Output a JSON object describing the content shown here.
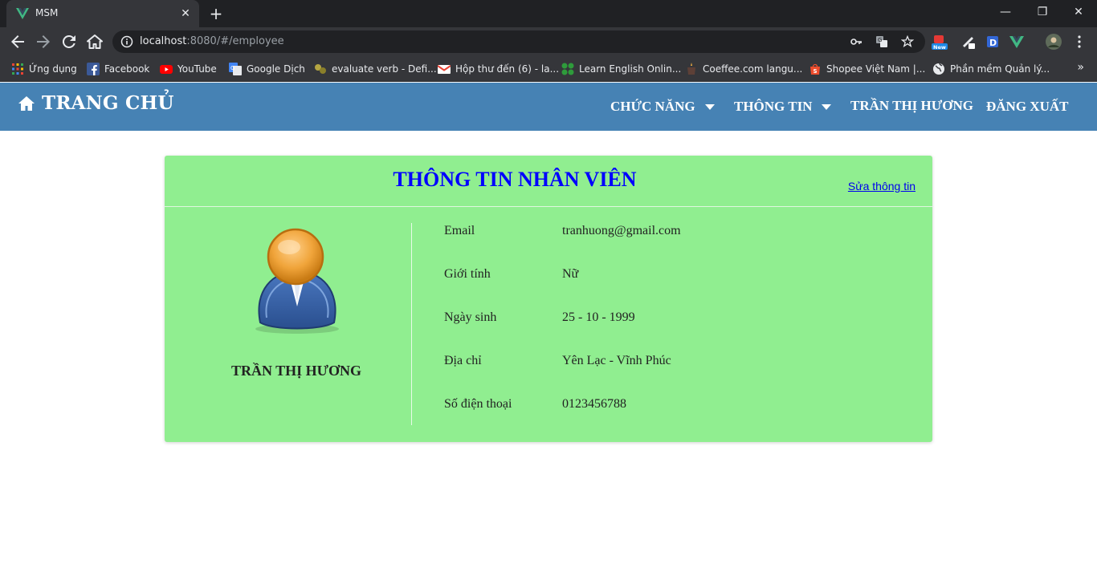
{
  "browser": {
    "tab_title": "MSM",
    "url_host": "localhost",
    "url_rest": ":8080/#/employee",
    "bookmarks": [
      {
        "label": "Ứng dụng",
        "icon": "apps-grid-icon"
      },
      {
        "label": "Facebook",
        "icon": "facebook-icon"
      },
      {
        "label": "YouTube",
        "icon": "youtube-icon"
      },
      {
        "label": "Google Dịch",
        "icon": "google-translate-icon"
      },
      {
        "label": "evaluate verb - Defi...",
        "icon": "dictionary-icon"
      },
      {
        "label": "Hộp thư đến (6) - la...",
        "icon": "gmail-icon"
      },
      {
        "label": "Learn English Onlin...",
        "icon": "learn-english-icon"
      },
      {
        "label": "Coeffee.com langu...",
        "icon": "coeffee-icon"
      },
      {
        "label": "Shopee Việt Nam |...",
        "icon": "shopee-icon"
      },
      {
        "label": "Phần mềm Quản lý...",
        "icon": "globe-icon"
      }
    ]
  },
  "navbar": {
    "brand": "TRANG CHỦ",
    "menu_functions": "CHỨC NĂNG",
    "menu_info": "THÔNG TIN",
    "user_name": "TRẦN THỊ HƯƠNG",
    "logout": "ĐĂNG XUẤT",
    "bg_color": "#4682b4"
  },
  "card": {
    "title": "THÔNG TIN NHÂN VIÊN",
    "edit_link": "Sửa thông tin",
    "employee_name": "TRẦN THỊ HƯƠNG",
    "bg_color": "#90ee90",
    "fields": {
      "email": {
        "label": "Email",
        "value": "tranhuong@gmail.com"
      },
      "gender": {
        "label": "Giới tính",
        "value": "Nữ"
      },
      "birthday": {
        "label": "Ngày sinh",
        "value": "25 - 10 - 1999"
      },
      "address": {
        "label": "Địa chỉ",
        "value": "Yên Lạc - Vĩnh Phúc"
      },
      "phone": {
        "label": "Số điện thoại",
        "value": "0123456788"
      }
    }
  }
}
